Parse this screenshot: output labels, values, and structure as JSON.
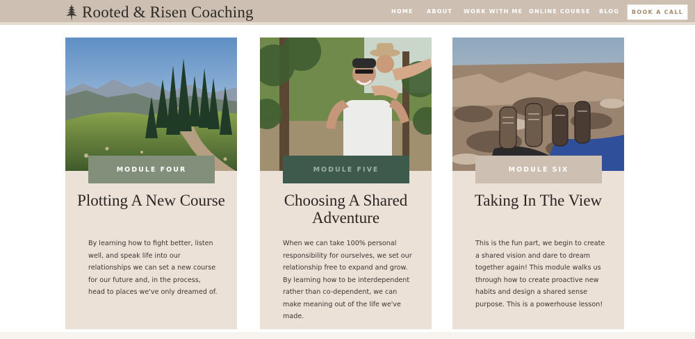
{
  "header": {
    "brand": "Rooted & Risen Coaching",
    "nav": [
      "HOME",
      "ABOUT",
      "WORK WITH ME",
      "ONLINE COURSE",
      "BLOG"
    ],
    "cta": "BOOK A CALL",
    "colors": {
      "bar": "#cdbfb1",
      "cta_text": "#a68a6a"
    },
    "icons": {
      "logo": "pine-tree-icon"
    }
  },
  "modules": [
    {
      "badge": "MODULE FOUR",
      "badge_color": "#818f7b",
      "badge_text_color": "#ffffff",
      "title": "Plotting A New Course",
      "body": "By learning how to fight better, listen well, and speak life into our relationships we can set a new course for our future and, in the process, head to places we've only dreamed of.",
      "photo": "mountain trail through pine forest"
    },
    {
      "badge": "MODULE FIVE",
      "badge_color": "#3d5a4d",
      "badge_text_color": "#9cb1a4",
      "title": "Choosing A Shared Adventure",
      "body": "When we can take 100% personal responsibility for ourselves, we set our relationship free to expand and grow. By learning how to be interdependent rather than co-dependent, we can make meaning out of the life we've made.",
      "photo": "couple piggyback in forest"
    },
    {
      "badge": "MODULE SIX",
      "badge_color": "#cdbfb1",
      "badge_text_color": "#ffffff",
      "title": "Taking In The View",
      "body": "This is the fun part, we begin to create a shared vision and dare to dream together again! This module walks us through how to create proactive new habits and design a shared sense purpose. This is a powerhouse lesson!",
      "photo": "hiking boots on rocky summit"
    }
  ]
}
